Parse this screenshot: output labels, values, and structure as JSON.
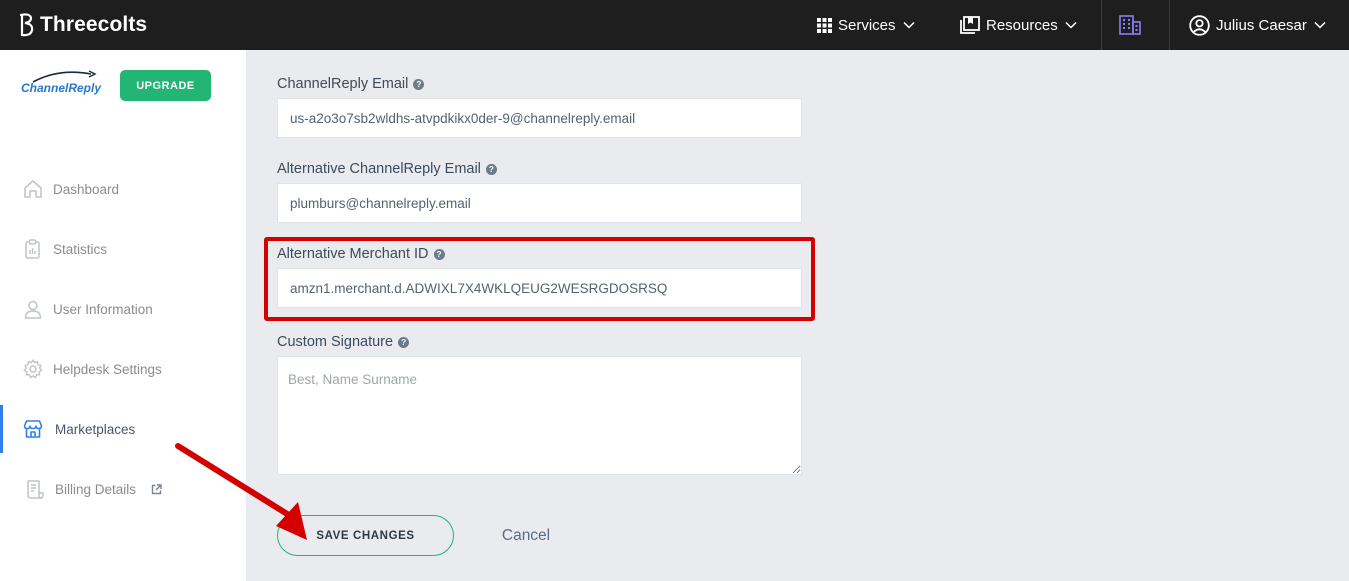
{
  "topbar": {
    "brand": "Threecolts",
    "services_label": "Services",
    "resources_label": "Resources",
    "user_name": "Julius Caesar"
  },
  "sidebar": {
    "logo_text": "ChannelReply",
    "upgrade_label": "UPGRADE",
    "items": [
      {
        "label": "Dashboard",
        "icon": "home-icon"
      },
      {
        "label": "Statistics",
        "icon": "clipboard-icon"
      },
      {
        "label": "User Information",
        "icon": "user-icon"
      },
      {
        "label": "Helpdesk Settings",
        "icon": "gear-icon"
      },
      {
        "label": "Marketplaces",
        "icon": "store-icon",
        "active": true
      },
      {
        "label": "Billing Details",
        "icon": "receipt-icon",
        "external": true
      }
    ]
  },
  "form": {
    "channelreply_email": {
      "label": "ChannelReply Email",
      "value": "us-a2o3o7sb2wldhs-atvpdkikx0der-9@channelreply.email"
    },
    "alt_channelreply_email": {
      "label": "Alternative ChannelReply Email",
      "value": "plumburs@channelreply.email"
    },
    "alt_merchant_id": {
      "label": "Alternative Merchant ID",
      "value": "amzn1.merchant.d.ADWIXL7X4WKLQEUG2WESRGDOSRSQ"
    },
    "custom_signature": {
      "label": "Custom Signature",
      "placeholder": "Best, Name Surname"
    },
    "save_label": "SAVE CHANGES",
    "cancel_label": "Cancel"
  },
  "colors": {
    "topbar_bg": "#1e1e1e",
    "accent_green": "#22b573",
    "highlight_red": "#d40000",
    "active_blue": "#2f80ed"
  }
}
